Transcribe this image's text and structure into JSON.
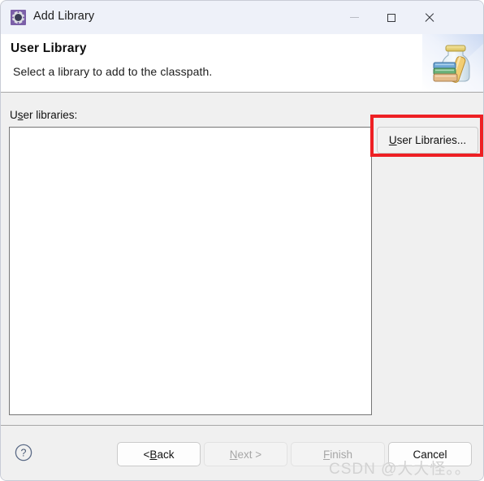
{
  "window": {
    "title": "Add Library",
    "icon": "eclipse-gear-icon",
    "controls": {
      "minimize": "minimize-icon",
      "maximize": "maximize-icon",
      "close": "close-icon"
    }
  },
  "header": {
    "title": "User Library",
    "description": "Select a library to add to the classpath.",
    "banner_icon": "library-jar-books-banner"
  },
  "main": {
    "field_label_prefix": "U",
    "field_label_mnemonic": "s",
    "field_label_suffix": "er libraries:",
    "field_label_full": "User libraries:",
    "list_items": [],
    "side_button": {
      "mnemonic": "U",
      "suffix": "ser Libraries...",
      "full_label": "User Libraries...",
      "highlighted": true,
      "highlight_color": "#ee2024"
    }
  },
  "footer": {
    "help_icon": "help-question-icon",
    "buttons": [
      {
        "id": "back",
        "prefix": "< ",
        "mnemonic": "B",
        "suffix": "ack",
        "full_label": "< Back",
        "enabled": true
      },
      {
        "id": "next",
        "prefix": "",
        "mnemonic": "N",
        "suffix": "ext >",
        "full_label": "Next >",
        "enabled": false
      },
      {
        "id": "finish",
        "prefix": "",
        "mnemonic": "F",
        "suffix": "inish",
        "full_label": "Finish",
        "enabled": false
      },
      {
        "id": "cancel",
        "prefix": "",
        "mnemonic": "",
        "suffix": "Cancel",
        "full_label": "Cancel",
        "enabled": true
      }
    ]
  },
  "watermark": "CSDN @大大怪。。"
}
